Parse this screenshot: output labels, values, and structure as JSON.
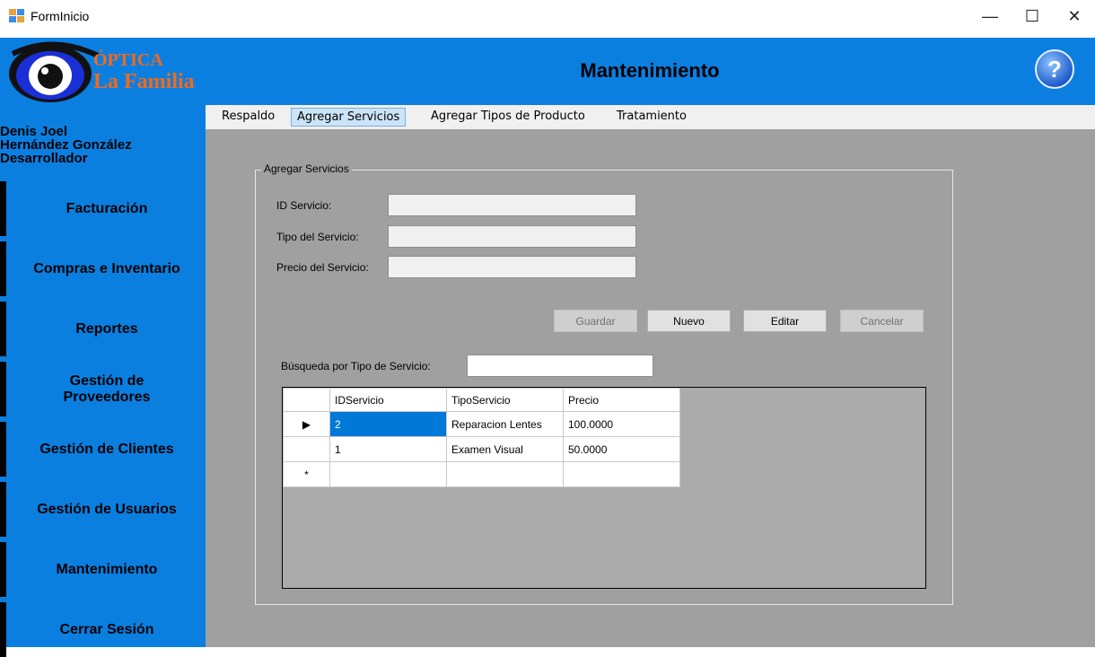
{
  "window": {
    "title": "FormInicio",
    "minimize": "—",
    "maximize": "☐",
    "close": "✕"
  },
  "header": {
    "logo_line1": "ÓPTICA",
    "logo_line2": "La Familia",
    "title": "Mantenimiento",
    "help_glyph": "?"
  },
  "user": {
    "name_line1": "Denis Joel",
    "name_line2": "Hernández González",
    "role": "Desarrollador"
  },
  "sidebar": {
    "items": [
      {
        "label": "Facturación"
      },
      {
        "label": "Compras e Inventario"
      },
      {
        "label": "Reportes"
      },
      {
        "label": "Gestión de Proveedores"
      },
      {
        "label": "Gestión de Clientes"
      },
      {
        "label": "Gestión de Usuarios"
      },
      {
        "label": "Mantenimiento"
      },
      {
        "label": "Cerrar Sesión"
      }
    ]
  },
  "tabs": [
    {
      "label": "Respaldo",
      "active": false
    },
    {
      "label": "Agregar Servicios",
      "active": true
    },
    {
      "label": "Agregar Tipos de Producto",
      "active": false
    },
    {
      "label": "Tratamiento",
      "active": false
    }
  ],
  "form": {
    "group_title": "Agregar Servicios",
    "id_label": "ID Servicio:",
    "id_value": "",
    "tipo_label": "Tipo del Servicio:",
    "tipo_value": "",
    "precio_label": "Precio del Servicio:",
    "precio_value": "",
    "buttons": {
      "guardar": "Guardar",
      "nuevo": "Nuevo",
      "editar": "Editar",
      "cancelar": "Cancelar"
    },
    "search_label": "Búsqueda por Tipo de Servicio:",
    "search_value": ""
  },
  "grid": {
    "columns": [
      "IDServicio",
      "TipoServicio",
      "Precio"
    ],
    "rows": [
      {
        "marker": "▶",
        "IDServicio": "2",
        "TipoServicio": "Reparacion Lentes",
        "Precio": "100.0000"
      },
      {
        "marker": "",
        "IDServicio": "1",
        "TipoServicio": "Examen Visual",
        "Precio": "50.0000"
      }
    ],
    "new_row_marker": "*"
  },
  "colors": {
    "accent_blue": "#0b7fe0",
    "content_gray": "#a0a0a0",
    "selection": "#0078d7"
  }
}
